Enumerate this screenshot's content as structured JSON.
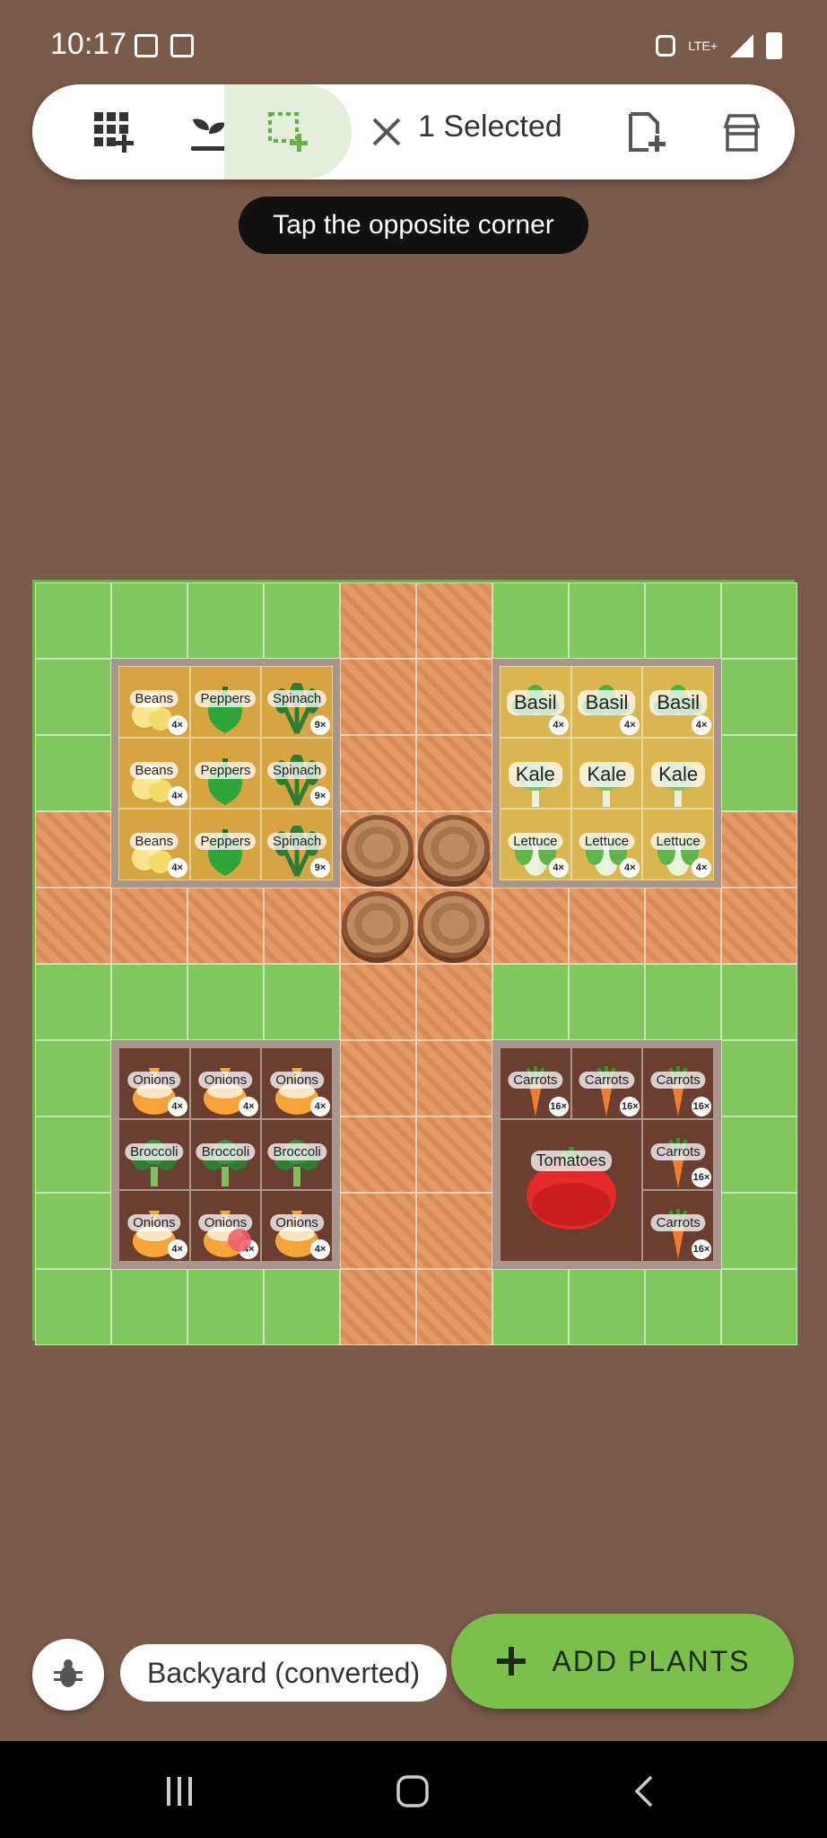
{
  "status_bar": {
    "time": "10:17",
    "network": "LTE+"
  },
  "toolbar": {
    "selection_label": "1 Selected",
    "buttons": [
      "grid-add-icon",
      "seedling-icon",
      "select-area-icon",
      "close-icon",
      "new-file-icon",
      "store-icon"
    ]
  },
  "tooltip": "Tap the opposite corner",
  "garden": {
    "beds": {
      "top_left": {
        "rows": [
          [
            {
              "name": "Beans",
              "count": "4×"
            },
            {
              "name": "Peppers",
              "count": ""
            },
            {
              "name": "Spinach",
              "count": "9×"
            }
          ],
          [
            {
              "name": "Beans",
              "count": "4×"
            },
            {
              "name": "Peppers",
              "count": ""
            },
            {
              "name": "Spinach",
              "count": "9×"
            }
          ],
          [
            {
              "name": "Beans",
              "count": "4×"
            },
            {
              "name": "Peppers",
              "count": ""
            },
            {
              "name": "Spinach",
              "count": "9×"
            }
          ]
        ]
      },
      "top_right": {
        "rows": [
          [
            {
              "name": "Basil",
              "count": "4×"
            },
            {
              "name": "Basil",
              "count": "4×"
            },
            {
              "name": "Basil",
              "count": "4×"
            }
          ],
          [
            {
              "name": "Kale",
              "count": ""
            },
            {
              "name": "Kale",
              "count": ""
            },
            {
              "name": "Kale",
              "count": ""
            }
          ],
          [
            {
              "name": "Lettuce",
              "count": "4×"
            },
            {
              "name": "Lettuce",
              "count": "4×"
            },
            {
              "name": "Lettuce",
              "count": "4×"
            }
          ]
        ]
      },
      "bottom_left": {
        "rows": [
          [
            {
              "name": "Onions",
              "count": "4×"
            },
            {
              "name": "Onions",
              "count": "4×"
            },
            {
              "name": "Onions",
              "count": "4×"
            }
          ],
          [
            {
              "name": "Broccoli",
              "count": ""
            },
            {
              "name": "Broccoli",
              "count": ""
            },
            {
              "name": "Broccoli",
              "count": ""
            }
          ],
          [
            {
              "name": "Onions",
              "count": "4×"
            },
            {
              "name": "Onions",
              "count": "4×"
            },
            {
              "name": "Onions",
              "count": "4×"
            }
          ]
        ]
      },
      "bottom_right": {
        "carrots_top": [
          {
            "name": "Carrots",
            "count": "16×"
          },
          {
            "name": "Carrots",
            "count": "16×"
          },
          {
            "name": "Carrots",
            "count": "16×"
          }
        ],
        "carrots_right": [
          {
            "name": "Carrots",
            "count": "16×"
          },
          {
            "name": "Carrots",
            "count": "16×"
          }
        ],
        "tomato": {
          "name": "Tomatoes"
        }
      }
    }
  },
  "garden_name": "Backyard (converted)",
  "add_plants_label": "ADD PLANTS",
  "colors": {
    "accent": "#7bbf4c",
    "background": "#7a5a4a",
    "grass": "#80c75d"
  }
}
